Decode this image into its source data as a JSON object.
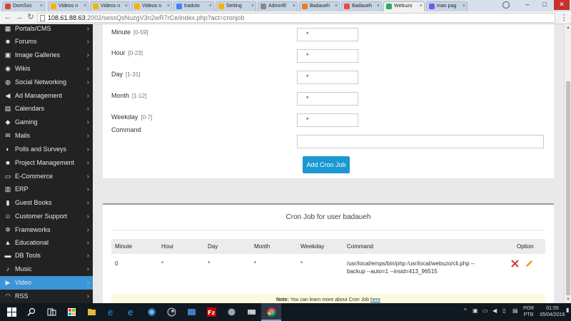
{
  "browser": {
    "tabs": [
      {
        "label": "DomSoc",
        "favicon_color": "#d44638"
      },
      {
        "label": "Videos n",
        "favicon_color": "#f4b400"
      },
      {
        "label": "Videos n",
        "favicon_color": "#f4b400"
      },
      {
        "label": "Videos n",
        "favicon_color": "#f4b400"
      },
      {
        "label": "traduto",
        "favicon_color": "#4285f4"
      },
      {
        "label": "Setting",
        "favicon_color": "#f4b400"
      },
      {
        "label": "Adminfil",
        "favicon_color": "#888888"
      },
      {
        "label": "Badaueh",
        "favicon_color": "#e67e22"
      },
      {
        "label": "Badaueh",
        "favicon_color": "#e74c3c"
      },
      {
        "label": "Webuzo",
        "favicon_color": "#27ae60"
      },
      {
        "label": "man pag",
        "favicon_color": "#6c5ce7"
      }
    ],
    "url_host": "108.61.88.63",
    "url_path": ":2002/sessQsNuzgV3n2wR7rCe/index.php?act=cronjob"
  },
  "sidebar": {
    "items": [
      {
        "label": "Portals/CMS",
        "icon": "grid-icon",
        "glyph": "▦"
      },
      {
        "label": "Forums",
        "icon": "users-icon",
        "glyph": "☻"
      },
      {
        "label": "Image Galleries",
        "icon": "image-icon",
        "glyph": "▣"
      },
      {
        "label": "Wikis",
        "icon": "globe-icon",
        "glyph": "◉"
      },
      {
        "label": "Social Networking",
        "icon": "share-icon",
        "glyph": "◍"
      },
      {
        "label": "Ad Management",
        "icon": "megaphone-icon",
        "glyph": "◀"
      },
      {
        "label": "Calendars",
        "icon": "calendar-icon",
        "glyph": "▤"
      },
      {
        "label": "Gaming",
        "icon": "gamepad-icon",
        "glyph": "◆"
      },
      {
        "label": "Mails",
        "icon": "envelope-icon",
        "glyph": "✉"
      },
      {
        "label": "Polls and Surveys",
        "icon": "poll-icon",
        "glyph": "◐"
      },
      {
        "label": "Project Management",
        "icon": "briefcase-icon",
        "glyph": "■"
      },
      {
        "label": "E-Commerce",
        "icon": "cart-icon",
        "glyph": "▭"
      },
      {
        "label": "ERP",
        "icon": "building-icon",
        "glyph": "▥"
      },
      {
        "label": "Guest Books",
        "icon": "book-icon",
        "glyph": "▮"
      },
      {
        "label": "Customer Support",
        "icon": "support-icon",
        "glyph": "☺"
      },
      {
        "label": "Frameworks",
        "icon": "cogs-icon",
        "glyph": "✲"
      },
      {
        "label": "Educational",
        "icon": "graduation-cap-icon",
        "glyph": "▲"
      },
      {
        "label": "DB Tools",
        "icon": "database-icon",
        "glyph": "▬"
      },
      {
        "label": "Music",
        "icon": "music-icon",
        "glyph": "♪"
      },
      {
        "label": "Video",
        "icon": "video-icon",
        "glyph": "▶"
      },
      {
        "label": "RSS",
        "icon": "rss-icon",
        "glyph": "◠"
      }
    ],
    "active_index": 19
  },
  "form": {
    "fields": [
      {
        "label": "Minute",
        "hint": "[0-59]",
        "value": "*"
      },
      {
        "label": "Hour",
        "hint": "[0-23]",
        "value": "*"
      },
      {
        "label": "Day",
        "hint": "[1-31]",
        "value": "*"
      },
      {
        "label": "Month",
        "hint": "[1-12]",
        "value": "*"
      },
      {
        "label": "Weekday",
        "hint": "[0-7]",
        "value": "*"
      }
    ],
    "command_label": "Command",
    "command_value": "",
    "submit_label": "Add Cron Job"
  },
  "cron_table": {
    "title": "Cron Job for user badaueh",
    "headers": [
      "Minute",
      "Hour",
      "Day",
      "Month",
      "Weekday",
      "Command",
      "Option"
    ],
    "rows": [
      {
        "minute": "0",
        "hour": "*",
        "day": "*",
        "month": "*",
        "weekday": "*",
        "command_lines": [
          "/usr/local/emps/bin/php /usr/local/webuzo/cli.php --",
          "backup --auto=1 --insid=413_96515"
        ]
      }
    ],
    "note_prefix": "Note:",
    "note_text": " You can learn more about Cron Job ",
    "note_link": "here"
  },
  "taskbar": {
    "lang_line1": "POR",
    "lang_line2": "PTB",
    "time": "01:55",
    "date": "05/04/2016"
  },
  "colors": {
    "accent": "#1998d2",
    "sidebar_bg": "#222222",
    "sidebar_active": "#3c95d9",
    "delete": "#d9342b",
    "edit": "#e6a21c"
  }
}
